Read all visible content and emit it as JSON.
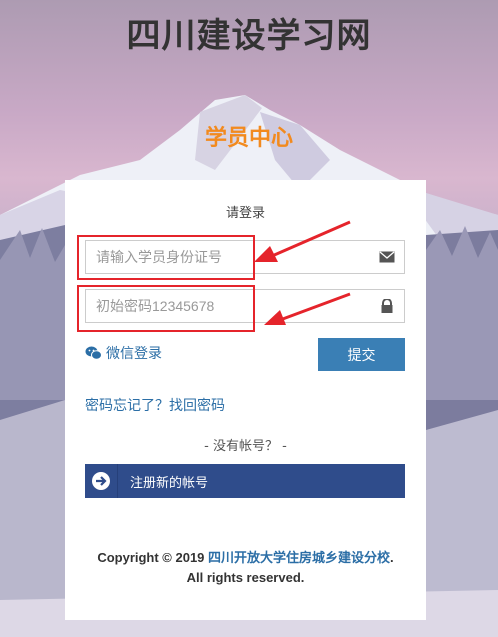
{
  "header": {
    "site_title": "四川建设学习网",
    "subtitle": "学员中心"
  },
  "login": {
    "heading": "请登录",
    "username_placeholder": "请输入学员身份证号",
    "password_placeholder": "初始密码12345678",
    "wechat_label": "微信登录",
    "submit_label": "提交",
    "forgot_label": "密码忘记了？找回密码",
    "no_account_label": "- 没有帐号？ -",
    "register_label": "注册新的帐号"
  },
  "footer": {
    "copyright_prefix": "Copyright © 2019 ",
    "org_link": "四川开放大学住房城乡建设分校",
    "copyright_suffix": ".",
    "rights": "All rights reserved."
  },
  "colors": {
    "title_orange": "#f28a1e",
    "link_blue": "#2b6ea6",
    "submit_blue": "#3a7fb5",
    "register_navy": "#2f4c8b",
    "annotation_red": "#e5242b"
  }
}
